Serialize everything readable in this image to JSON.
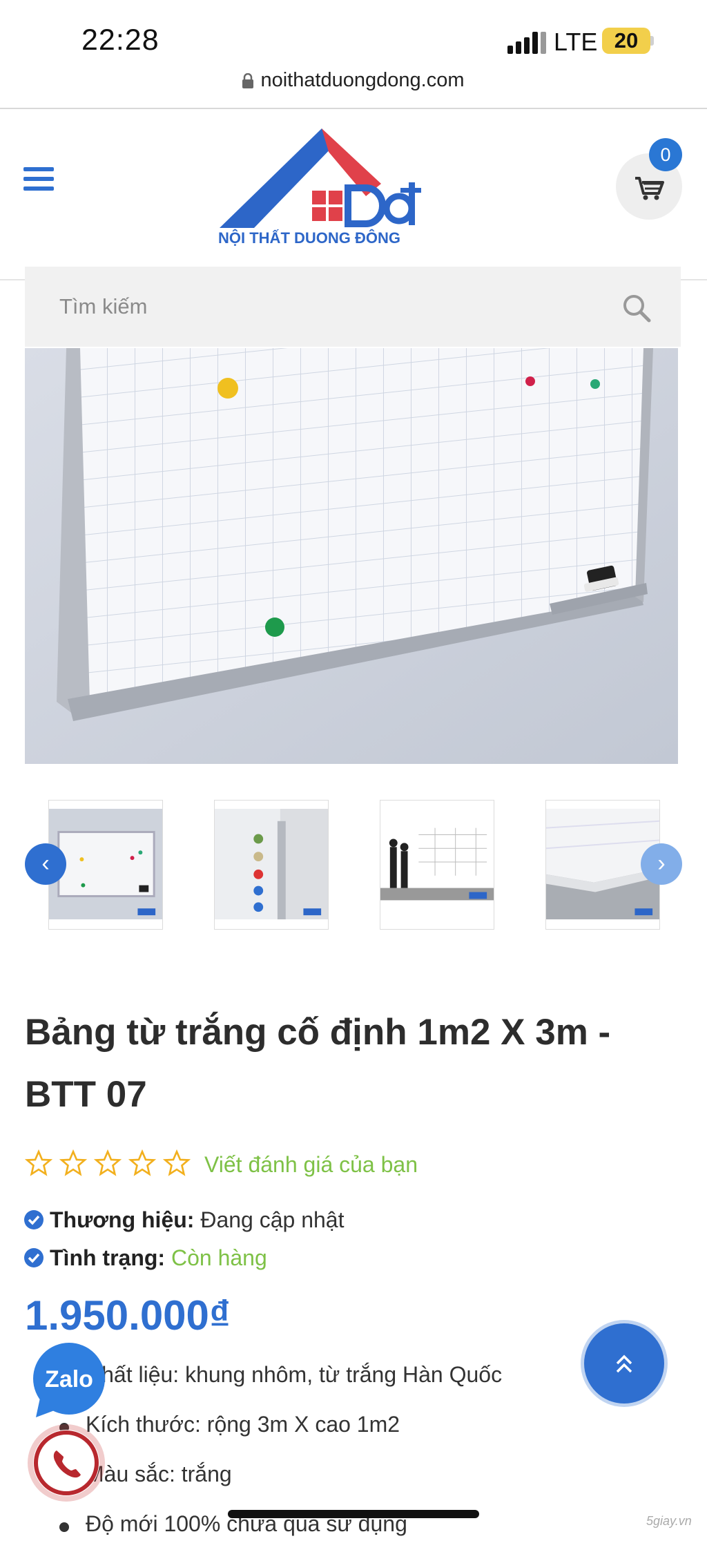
{
  "status_bar": {
    "time": "22:28",
    "network": "LTE",
    "battery": "20"
  },
  "browser": {
    "url": "noithatduongdong.com"
  },
  "header": {
    "logo_text": "NỘI THẤT DUONG ĐÔNG",
    "cart_count": "0"
  },
  "search": {
    "placeholder": "Tìm kiếm"
  },
  "product": {
    "title": "Bảng từ trắng cố định 1m2 X 3m - BTT 07",
    "rating_stars": 0,
    "review_link": "Viết đánh giá của bạn",
    "brand_label": "Thương hiệu:",
    "brand_value": "Đang cập nhật",
    "status_label": "Tình trạng:",
    "status_value": "Còn hàng",
    "price": "1.950.000₫",
    "features": [
      "Chất liệu: khung nhôm, từ trắng Hàn Quốc",
      "Kích thước: rộng 3m X  cao 1m2",
      "Màu sắc:  trắng",
      "Độ mới 100% chưa qua sử dụng"
    ]
  },
  "widgets": {
    "zalo_label": "Zalo"
  },
  "watermark": "5giay.vn",
  "colors": {
    "accent_blue": "#2f6fd0",
    "accent_green": "#7ec146",
    "logo_red": "#e0414a"
  }
}
